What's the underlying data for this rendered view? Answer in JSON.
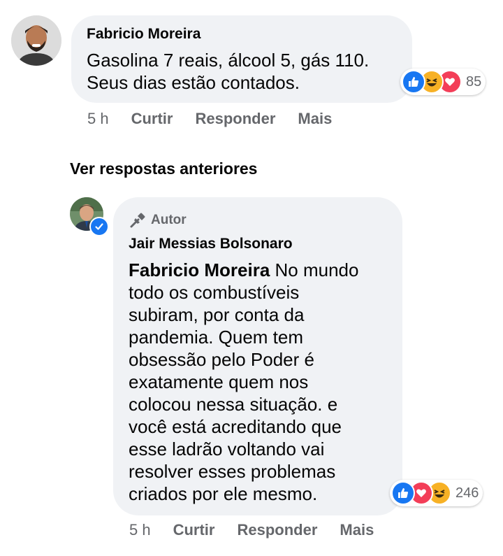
{
  "comment1": {
    "author": "Fabricio Moreira",
    "text_line1": "Gasolina 7 reais, álcool 5, gás 110.",
    "text_line2": "Seus dias estão contados.",
    "reaction_count": "85",
    "reactions": [
      "like-icon",
      "haha-icon",
      "love-icon"
    ],
    "time": "5 h",
    "like_label": "Curtir",
    "reply_label": "Responder",
    "more_label": "Mais"
  },
  "see_previous": "Ver respostas anteriores",
  "reply1": {
    "badge": "Autor",
    "author": "Jair Messias Bolsonaro",
    "mention": "Fabricio Moreira",
    "lines": [
      " No mundo",
      "todo os combustíveis",
      "subiram, por conta da",
      "pandemia. Quem tem",
      "obsessão pelo Poder é",
      "exatamente quem nos",
      "colocou nessa situação. e",
      "você está acreditando que",
      "esse ladrão voltando vai",
      "resolver esses problemas",
      "criados por ele mesmo."
    ],
    "reaction_count": "246",
    "reactions": [
      "like-icon",
      "love-icon",
      "haha-icon"
    ],
    "time": "5 h",
    "like_label": "Curtir",
    "reply_label": "Responder",
    "more_label": "Mais"
  },
  "colors": {
    "bubble": "#f0f2f5",
    "meta_text": "#65676b",
    "like_blue": "#1877f2",
    "love_red": "#f33e58",
    "haha_yellow": "#f7b125"
  }
}
